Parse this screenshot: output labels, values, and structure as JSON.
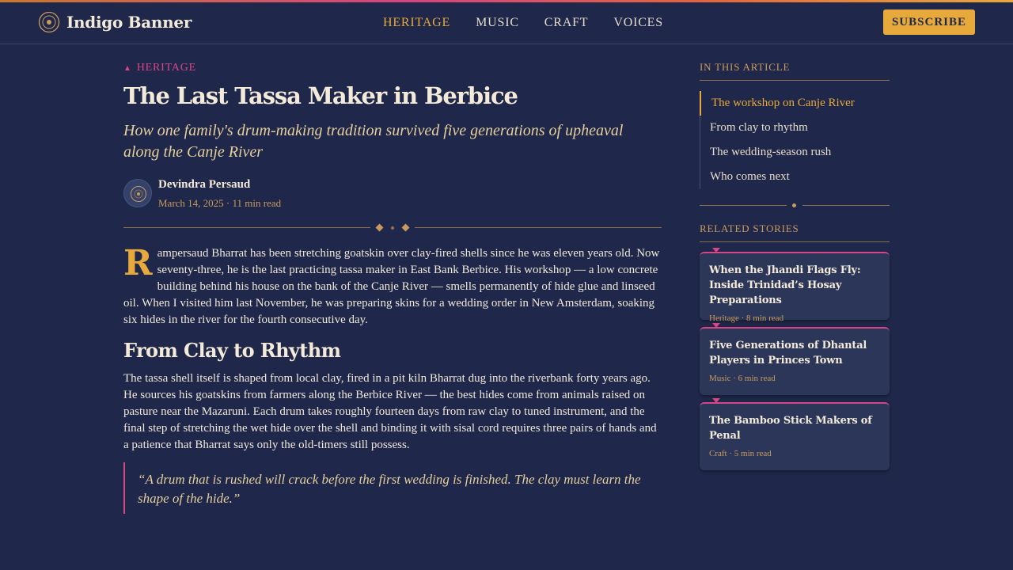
{
  "brand": {
    "name": "Indigo Banner",
    "accent": "#e7a93c",
    "magenta": "#d74787",
    "background": "#1f284a"
  },
  "nav": {
    "items": [
      "HERITAGE",
      "MUSIC",
      "CRAFT",
      "VOICES"
    ],
    "active": "HERITAGE"
  },
  "header": {
    "subscribe_label": "SUBSCRIBE"
  },
  "article": {
    "kicker": "HERITAGE",
    "title": "The Last Tassa Maker in Berbice",
    "dek": "How one family's drum-making tradition survived five generations of upheaval along the Canje River",
    "author": "Devindra Persaud",
    "meta": "March 14, 2025 · 11 min read",
    "dropcap": "R",
    "p1": "ampersaud Bharrat has been stretching goatskin over clay-fired shells since he was eleven years old. Now seventy-three, he is the last practicing tassa maker in East Bank Berbice. His workshop — a low concrete building behind his house on the bank of the Canje River — smells permanently of hide glue and linseed oil. When I visited him last November, he was preparing skins for a wedding order in New Amsterdam, soaking six hides in the river for the fourth consecutive day.",
    "h2": "From Clay to Rhythm",
    "p2": "The tassa shell itself is shaped from local clay, fired in a pit kiln Bharrat dug into the riverbank forty years ago. He sources his goatskins from farmers along the Berbice River — the best hides come from animals raised on pasture near the Mazaruni. Each drum takes roughly fourteen days from raw clay to tuned instrument, and the final step of stretching the wet hide over the shell and binding it with sisal cord requires three pairs of hands and a patience that Bharrat says only the old-timers still possess.",
    "quote": "“A drum that is rushed will crack before the first wedding is finished. The clay must learn the shape of the hide.”"
  },
  "sidebar": {
    "toc_heading": "IN THIS ARTICLE",
    "toc": [
      {
        "label": "The workshop on Canje River",
        "active": true
      },
      {
        "label": "From clay to rhythm",
        "active": false
      },
      {
        "label": "The wedding-season rush",
        "active": false
      },
      {
        "label": "Who comes next",
        "active": false
      }
    ],
    "related_heading": "RELATED STORIES",
    "related": [
      {
        "title": "When the Jhandi Flags Fly: Inside Trinidad’s Hosay Preparations",
        "meta": "Heritage · 8 min read"
      },
      {
        "title": "Five Generations of Dhantal Players in Princes Town",
        "meta": "Music · 6 min read"
      },
      {
        "title": "The Bamboo Stick Makers of Penal",
        "meta": "Craft · 5 min read"
      }
    ]
  },
  "icons": {
    "brand": "brand-emblem-icon",
    "avatar": "author-avatar-icon",
    "divider": "ornament-divider-icon",
    "kicker": "triangle-icon"
  }
}
